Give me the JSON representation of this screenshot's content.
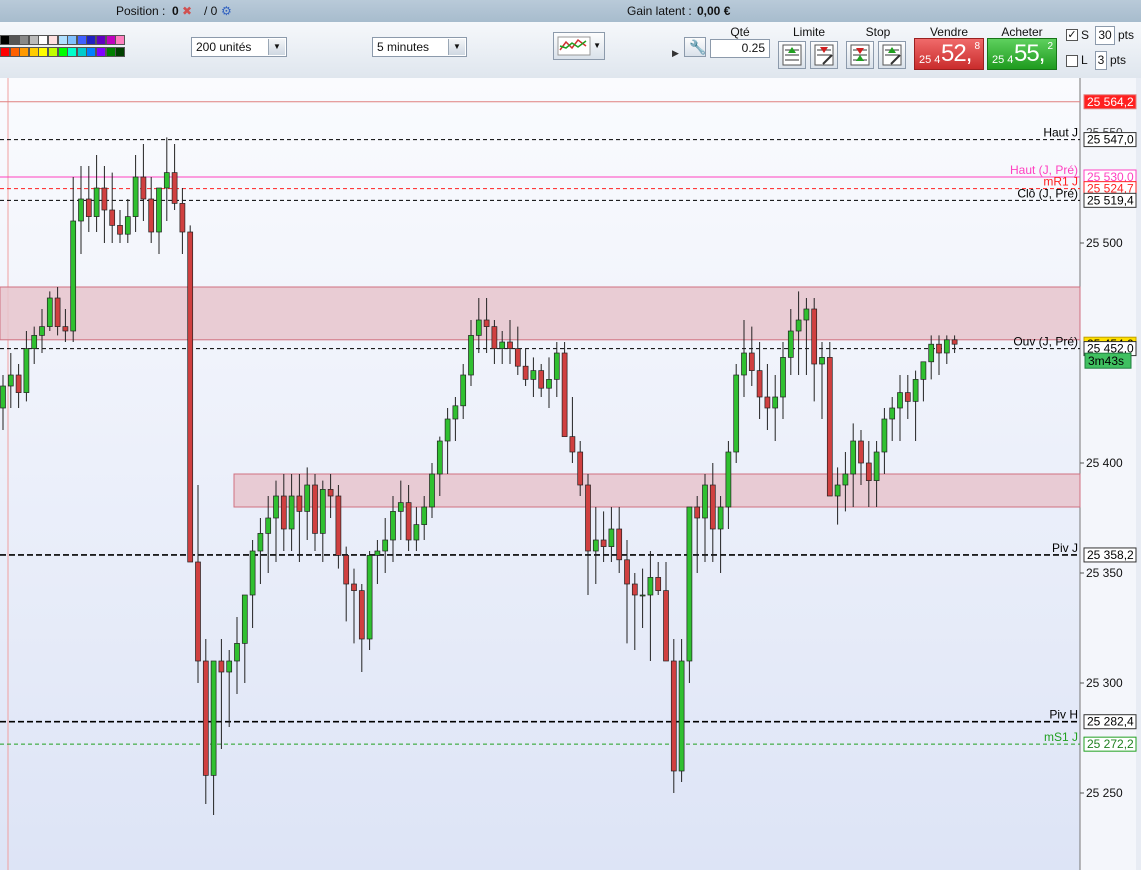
{
  "header": {
    "position_label": "Position :",
    "position_value": "0",
    "position_sep": "/ 0",
    "gain_label": "Gain latent :",
    "gain_value": "0,00 €"
  },
  "toolbar": {
    "units": "200 unités",
    "interval": "5 minutes",
    "qty_label": "Qté",
    "qty_value": "0.25",
    "limit_label": "Limite",
    "stop_label": "Stop",
    "sell_label": "Vendre",
    "buy_label": "Acheter",
    "sell_small": "25 4",
    "sell_big": "52,",
    "sell_sup": "8",
    "buy_small": "25 4",
    "buy_big": "55,",
    "buy_sup": "2",
    "s_label": "S",
    "s_value": "30",
    "s_unit": "pts",
    "l_label": "L",
    "l_value": "3",
    "l_unit": "pts",
    "palette_colors": [
      "#000000",
      "#555555",
      "#888888",
      "#bbbbbb",
      "#ffffff",
      "#ffe0e0",
      "#b0e0ff",
      "#80c0ff",
      "#4060ff",
      "#2020c0",
      "#6000c0",
      "#c000c0",
      "#ff80c0",
      "#ff0000",
      "#ff6000",
      "#ff9900",
      "#ffcc00",
      "#ffff00",
      "#c0ff00",
      "#00ff00",
      "#00ffcc",
      "#00cccc",
      "#0080ff",
      "#8000ff",
      "#008000",
      "#004000"
    ]
  },
  "chart_data": {
    "type": "candlestick",
    "ylim": [
      25215,
      25575
    ],
    "y_ticks": [
      "25 500",
      "25 400",
      "25 350",
      "25 300",
      "25 250"
    ],
    "y_tick_values": [
      25500,
      25400,
      25350,
      25300,
      25250
    ],
    "zones": [
      {
        "from_bar": 0,
        "to_bar": 999,
        "y_low": 25456,
        "y_high": 25480,
        "color": "#e8c4cc"
      },
      {
        "from_bar": 30,
        "to_bar": 999,
        "y_low": 25380,
        "y_high": 25395,
        "color": "#e8c4cc"
      }
    ],
    "levels": [
      {
        "label": "",
        "value": 25564.2,
        "tag": "25 564,2",
        "color": "#e08080",
        "style": "solid",
        "tag_bg": "#ff2020",
        "tag_fg": "#ffffff"
      },
      {
        "label": "Haut J",
        "value": 25547.0,
        "tag": "25 547,0",
        "color": "#000000",
        "style": "dash",
        "tag_bg": "#ffffff",
        "tag_fg": "#000000",
        "hidden_tag": "25 550"
      },
      {
        "label": "Haut (J, Pré)",
        "value": 25530.0,
        "tag": "25 530,0",
        "color": "#ff40c0",
        "style": "solid",
        "tag_bg": "#ffffff",
        "tag_fg": "#ff40c0"
      },
      {
        "label": "mR1 J",
        "value": 25524.7,
        "tag": "25 524,7",
        "color": "#ff2020",
        "style": "dash",
        "tag_bg": "#ffffff",
        "tag_fg": "#ff2020"
      },
      {
        "label": "Clô (J, Pré)",
        "value": 25519.4,
        "tag": "25 519,4",
        "color": "#000000",
        "style": "dash",
        "tag_bg": "#ffffff",
        "tag_fg": "#000000"
      },
      {
        "label": "",
        "value": 25454.0,
        "tag": "25 454,0",
        "color": "#c0a000",
        "style": "none",
        "tag_bg": "#ffe000",
        "tag_fg": "#000000"
      },
      {
        "label": "Ouv (J, Pré)",
        "value": 25452.0,
        "tag": "25 452,0",
        "color": "#000000",
        "style": "dash",
        "tag_bg": "#ffffff",
        "tag_fg": "#000000"
      },
      {
        "label": "Piv J",
        "value": 25358.2,
        "tag": "25 358,2",
        "color": "#000000",
        "style": "bigdash",
        "tag_bg": "#ffffff",
        "tag_fg": "#000000"
      },
      {
        "label": "Piv H",
        "value": 25282.4,
        "tag": "25 282,4",
        "color": "#000000",
        "style": "bigdash",
        "tag_bg": "#ffffff",
        "tag_fg": "#000000"
      },
      {
        "label": "mS1 J",
        "value": 25272.2,
        "tag": "25 272,2",
        "color": "#20a020",
        "style": "dash",
        "tag_bg": "#ffffff",
        "tag_fg": "#208020"
      }
    ],
    "countdown": "3m43s",
    "candles": [
      [
        25425,
        25440,
        25415,
        25435
      ],
      [
        25435,
        25450,
        25425,
        25440
      ],
      [
        25440,
        25445,
        25425,
        25432
      ],
      [
        25432,
        25460,
        25428,
        25452
      ],
      [
        25452,
        25462,
        25445,
        25458
      ],
      [
        25458,
        25470,
        25450,
        25462
      ],
      [
        25462,
        25478,
        25460,
        25475
      ],
      [
        25475,
        25480,
        25458,
        25462
      ],
      [
        25462,
        25470,
        25455,
        25460
      ],
      [
        25460,
        25530,
        25455,
        25510
      ],
      [
        25510,
        25535,
        25495,
        25520
      ],
      [
        25520,
        25535,
        25505,
        25512
      ],
      [
        25512,
        25540,
        25505,
        25525
      ],
      [
        25525,
        25535,
        25500,
        25515
      ],
      [
        25515,
        25532,
        25500,
        25508
      ],
      [
        25508,
        25515,
        25500,
        25504
      ],
      [
        25504,
        25520,
        25500,
        25512
      ],
      [
        25512,
        25540,
        25505,
        25530
      ],
      [
        25530,
        25545,
        25510,
        25520
      ],
      [
        25520,
        25530,
        25500,
        25505
      ],
      [
        25505,
        25520,
        25495,
        25525
      ],
      [
        25525,
        25548,
        25510,
        25532
      ],
      [
        25532,
        25545,
        25515,
        25518
      ],
      [
        25518,
        25525,
        25495,
        25505
      ],
      [
        25505,
        25508,
        25450,
        25355
      ],
      [
        25355,
        25390,
        25300,
        25310
      ],
      [
        25310,
        25320,
        25245,
        25258
      ],
      [
        25258,
        25308,
        25240,
        25310
      ],
      [
        25310,
        25320,
        25270,
        25305
      ],
      [
        25305,
        25315,
        25280,
        25310
      ],
      [
        25310,
        25330,
        25295,
        25318
      ],
      [
        25318,
        25335,
        25300,
        25340
      ],
      [
        25340,
        25365,
        25325,
        25360
      ],
      [
        25360,
        25375,
        25345,
        25368
      ],
      [
        25368,
        25385,
        25350,
        25375
      ],
      [
        25375,
        25392,
        25355,
        25385
      ],
      [
        25385,
        25395,
        25360,
        25370
      ],
      [
        25370,
        25395,
        25360,
        25385
      ],
      [
        25385,
        25395,
        25355,
        25378
      ],
      [
        25378,
        25398,
        25365,
        25390
      ],
      [
        25390,
        25395,
        25360,
        25368
      ],
      [
        25368,
        25392,
        25355,
        25388
      ],
      [
        25388,
        25395,
        25375,
        25385
      ],
      [
        25385,
        25390,
        25352,
        25358
      ],
      [
        25358,
        25362,
        25328,
        25345
      ],
      [
        25345,
        25352,
        25318,
        25342
      ],
      [
        25342,
        25345,
        25305,
        25320
      ],
      [
        25320,
        25360,
        25315,
        25358
      ],
      [
        25358,
        25365,
        25345,
        25360
      ],
      [
        25360,
        25375,
        25350,
        25365
      ],
      [
        25365,
        25385,
        25355,
        25378
      ],
      [
        25378,
        25392,
        25365,
        25382
      ],
      [
        25382,
        25390,
        25360,
        25365
      ],
      [
        25365,
        25380,
        25360,
        25372
      ],
      [
        25372,
        25385,
        25365,
        25380
      ],
      [
        25380,
        25400,
        25375,
        25395
      ],
      [
        25395,
        25412,
        25385,
        25410
      ],
      [
        25410,
        25425,
        25395,
        25420
      ],
      [
        25420,
        25430,
        25410,
        25426
      ],
      [
        25426,
        25445,
        25420,
        25440
      ],
      [
        25440,
        25465,
        25435,
        25458
      ],
      [
        25458,
        25475,
        25450,
        25465
      ],
      [
        25465,
        25475,
        25450,
        25462
      ],
      [
        25462,
        25465,
        25445,
        25452
      ],
      [
        25452,
        25460,
        25445,
        25455
      ],
      [
        25455,
        25465,
        25445,
        25452
      ],
      [
        25452,
        25462,
        25440,
        25444
      ],
      [
        25444,
        25452,
        25435,
        25438
      ],
      [
        25438,
        25448,
        25430,
        25442
      ],
      [
        25442,
        25445,
        25430,
        25434
      ],
      [
        25434,
        25448,
        25425,
        25438
      ],
      [
        25438,
        25455,
        25430,
        25450
      ],
      [
        25450,
        25455,
        25420,
        25412
      ],
      [
        25412,
        25430,
        25400,
        25405
      ],
      [
        25405,
        25410,
        25385,
        25390
      ],
      [
        25390,
        25395,
        25340,
        25360
      ],
      [
        25360,
        25380,
        25345,
        25365
      ],
      [
        25365,
        25378,
        25355,
        25362
      ],
      [
        25362,
        25380,
        25355,
        25370
      ],
      [
        25370,
        25380,
        25350,
        25356
      ],
      [
        25356,
        25365,
        25318,
        25345
      ],
      [
        25345,
        25350,
        25315,
        25340
      ],
      [
        25340,
        25352,
        25325,
        25340
      ],
      [
        25340,
        25360,
        25310,
        25348
      ],
      [
        25348,
        25355,
        25340,
        25342
      ],
      [
        25342,
        25355,
        25310,
        25310
      ],
      [
        25310,
        25320,
        25250,
        25260
      ],
      [
        25260,
        25320,
        25255,
        25310
      ],
      [
        25310,
        25380,
        25300,
        25380
      ],
      [
        25380,
        25385,
        25350,
        25375
      ],
      [
        25375,
        25395,
        25355,
        25390
      ],
      [
        25390,
        25400,
        25355,
        25370
      ],
      [
        25370,
        25385,
        25350,
        25380
      ],
      [
        25380,
        25410,
        25370,
        25405
      ],
      [
        25405,
        25445,
        25400,
        25440
      ],
      [
        25440,
        25465,
        25430,
        25450
      ],
      [
        25450,
        25462,
        25435,
        25442
      ],
      [
        25442,
        25455,
        25420,
        25430
      ],
      [
        25430,
        25445,
        25415,
        25425
      ],
      [
        25425,
        25440,
        25410,
        25430
      ],
      [
        25430,
        25455,
        25420,
        25448
      ],
      [
        25448,
        25470,
        25440,
        25460
      ],
      [
        25460,
        25478,
        25440,
        25465
      ],
      [
        25465,
        25475,
        25440,
        25470
      ],
      [
        25470,
        25475,
        25428,
        25445
      ],
      [
        25445,
        25455,
        25420,
        25448
      ],
      [
        25448,
        25455,
        25400,
        25385
      ],
      [
        25385,
        25398,
        25372,
        25390
      ],
      [
        25390,
        25405,
        25378,
        25395
      ],
      [
        25395,
        25418,
        25380,
        25410
      ],
      [
        25410,
        25415,
        25390,
        25400
      ],
      [
        25400,
        25410,
        25380,
        25392
      ],
      [
        25392,
        25410,
        25380,
        25405
      ],
      [
        25405,
        25425,
        25395,
        25420
      ],
      [
        25420,
        25430,
        25410,
        25425
      ],
      [
        25425,
        25440,
        25410,
        25432
      ],
      [
        25432,
        25440,
        25420,
        25428
      ],
      [
        25428,
        25442,
        25410,
        25438
      ],
      [
        25438,
        25445,
        25428,
        25446
      ],
      [
        25446,
        25458,
        25438,
        25454
      ],
      [
        25454,
        25458,
        25440,
        25450
      ],
      [
        25450,
        25458,
        25445,
        25456
      ],
      [
        25456,
        25458,
        25450,
        25454
      ]
    ],
    "bar_spacing": 7.8,
    "up_color": "#30c030",
    "down_color": "#d04040"
  }
}
